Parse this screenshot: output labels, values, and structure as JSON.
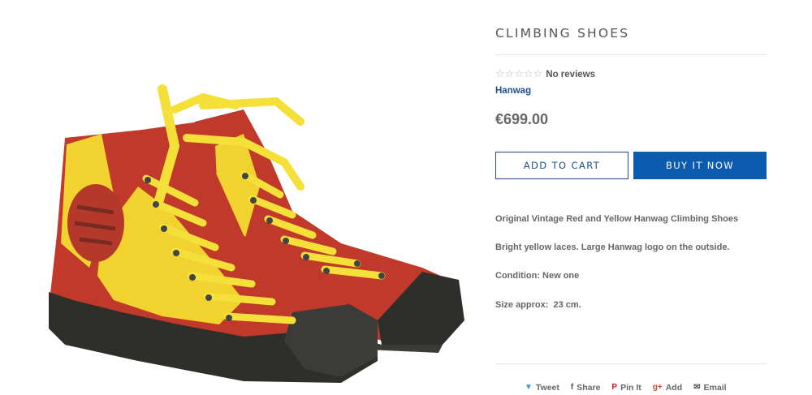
{
  "product": {
    "title": "CLIMBING SHOES",
    "reviews_text": "No reviews",
    "rating": 0,
    "rating_max": 5,
    "vendor": "Hanwag",
    "price": "€699.00",
    "add_to_cart_label": "ADD TO CART",
    "buy_now_label": "BUY IT NOW",
    "description": [
      "Original Vintage Red and Yellow Hanwag Climbing Shoes",
      "Bright yellow laces. Large Hanwag logo on the outside.",
      "Condition: New one",
      "Size approx:  23 cm."
    ],
    "image_icon": "climbing-shoes-photo"
  },
  "share": [
    {
      "icon": "twitter-icon",
      "glyph": "🐦",
      "label": "Tweet"
    },
    {
      "icon": "facebook-icon",
      "glyph": "f",
      "label": "Share"
    },
    {
      "icon": "pinterest-icon",
      "glyph": "P",
      "label": "Pin It"
    },
    {
      "icon": "google-plus-icon",
      "glyph": "g+",
      "label": "Add"
    },
    {
      "icon": "email-icon",
      "glyph": "✉",
      "label": "Email"
    }
  ],
  "colors": {
    "accent": "#1e4f8c",
    "button_fill": "#0b5bb0",
    "shoe_red": "#c0392b",
    "shoe_yellow": "#f2d22e",
    "sole": "#2e2e2b"
  }
}
